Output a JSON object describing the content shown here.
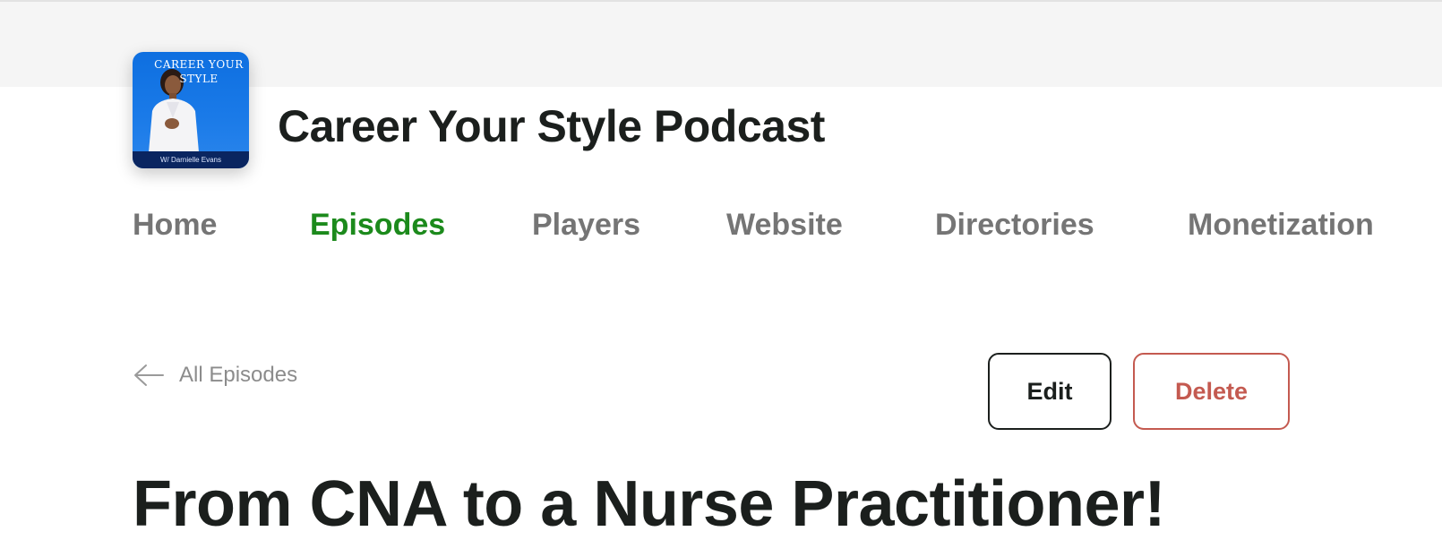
{
  "colors": {
    "accent": "#1c8a1c",
    "nav_inactive": "#757575",
    "danger": "#c45a50",
    "text": "#1b1f1d",
    "top_band": "#f5f5f5"
  },
  "podcast": {
    "title": "Career Your Style Podcast",
    "cover": {
      "title": "CAREER YOUR STYLE",
      "footer": "W/ Darnielle Evans"
    }
  },
  "nav": {
    "items": [
      {
        "label": "Home",
        "active": false
      },
      {
        "label": "Episodes",
        "active": true
      },
      {
        "label": "Players",
        "active": false
      },
      {
        "label": "Website",
        "active": false
      },
      {
        "label": "Directories",
        "active": false
      },
      {
        "label": "Monetization",
        "active": false
      }
    ]
  },
  "episode": {
    "back_icon": "arrow-left-icon",
    "back_label": "All Episodes",
    "edit_label": "Edit",
    "delete_label": "Delete",
    "title": "From CNA to a Nurse Practitioner!"
  }
}
